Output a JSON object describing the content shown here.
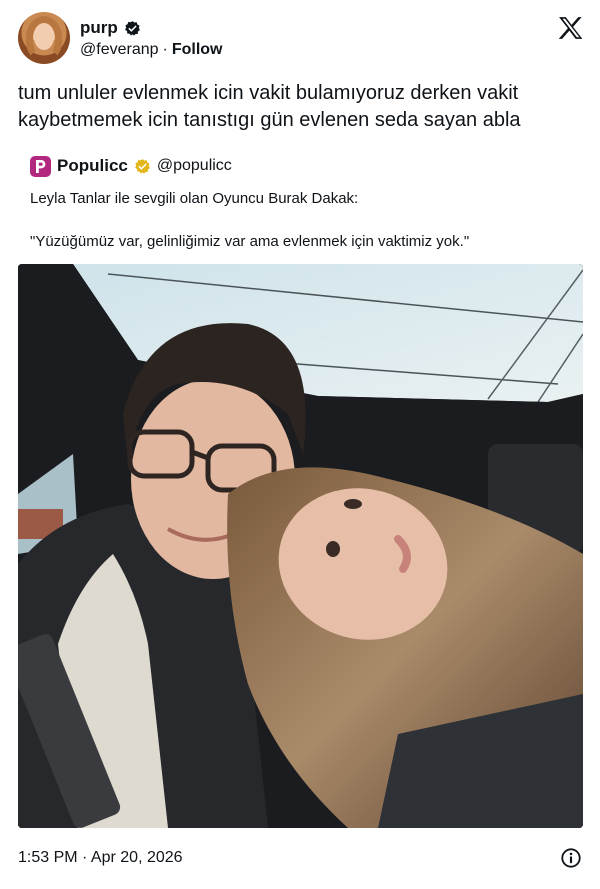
{
  "author": {
    "display_name": "purp",
    "handle": "@feveranp",
    "separator": "·",
    "follow_label": "Follow"
  },
  "tweet": {
    "text": "tum unluler evlenmek icin vakit bulamıyoruz derken vakit kaybetmemek icin tanıstıgı gün evlenen seda sayan abla"
  },
  "quoted": {
    "display_name": "Populicc",
    "handle": "@populicc",
    "line1": "Leyla Tanlar ile sevgili olan Oyuncu Burak Dakak:",
    "line2": "\"Yüzüğümüz var, gelinliğimiz var ama evlenmek için vaktimiz yok.\"",
    "logo_letter": "P"
  },
  "footer": {
    "timestamp": "1:53 PM · Apr 20, 2026"
  },
  "icons": {
    "verified": "verified-badge-icon",
    "gold_verified": "gold-verified-badge-icon",
    "x_logo": "x-logo-icon",
    "info": "info-icon"
  },
  "colors": {
    "text": "#0f1419",
    "populicc_brand": "#b3287f",
    "gold_badge": "#e2b719"
  }
}
